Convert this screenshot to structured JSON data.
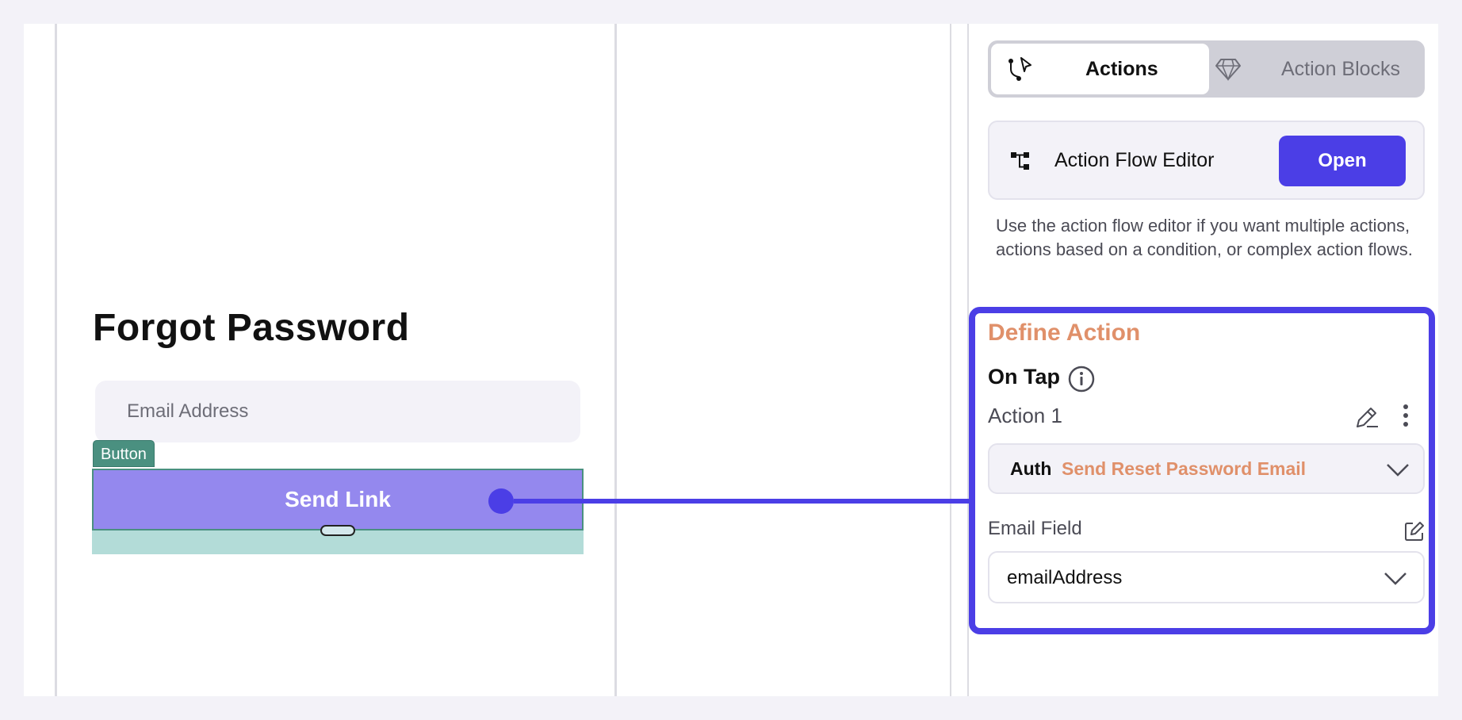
{
  "canvas": {
    "page_title": "Forgot Password",
    "email_placeholder": "Email Address",
    "widget_tag": "Button",
    "button_label": "Send Link"
  },
  "panel": {
    "tabs": [
      {
        "label": "Actions",
        "icon": "flow-cursor-icon",
        "active": true
      },
      {
        "label": "Action Blocks",
        "icon": "diamond-icon",
        "active": false
      }
    ],
    "flow_editor": {
      "label": "Action Flow Editor",
      "icon": "flow-tree-icon",
      "open_label": "Open",
      "description": "Use the action flow editor if you want multiple actions, actions based on a condition, or complex action flows."
    },
    "define_action": {
      "title": "Define Action",
      "trigger": "On Tap",
      "action_name": "Action 1",
      "action_category": "Auth",
      "action_type": "Send Reset Password Email",
      "email_field_label": "Email Field",
      "email_field_value": "emailAddress"
    }
  },
  "colors": {
    "accent": "#4b3ee6",
    "button_fill": "#9488ee",
    "tag_green": "#4a9080",
    "orange": "#e0906a"
  }
}
